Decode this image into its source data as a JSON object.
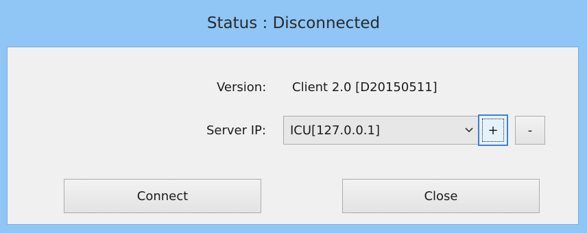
{
  "window": {
    "title": "Status : Disconnected",
    "title_bar_color": "#8fc6f6"
  },
  "version": {
    "label": "Version:",
    "value": "Client 2.0 [D20150511]"
  },
  "server": {
    "label": "Server IP:",
    "selected": "ICU[127.0.0.1]",
    "dropdown_icon": "chevron-down-icon",
    "add_label": "+",
    "remove_label": "-"
  },
  "actions": {
    "connect_label": "Connect",
    "close_label": "Close"
  }
}
